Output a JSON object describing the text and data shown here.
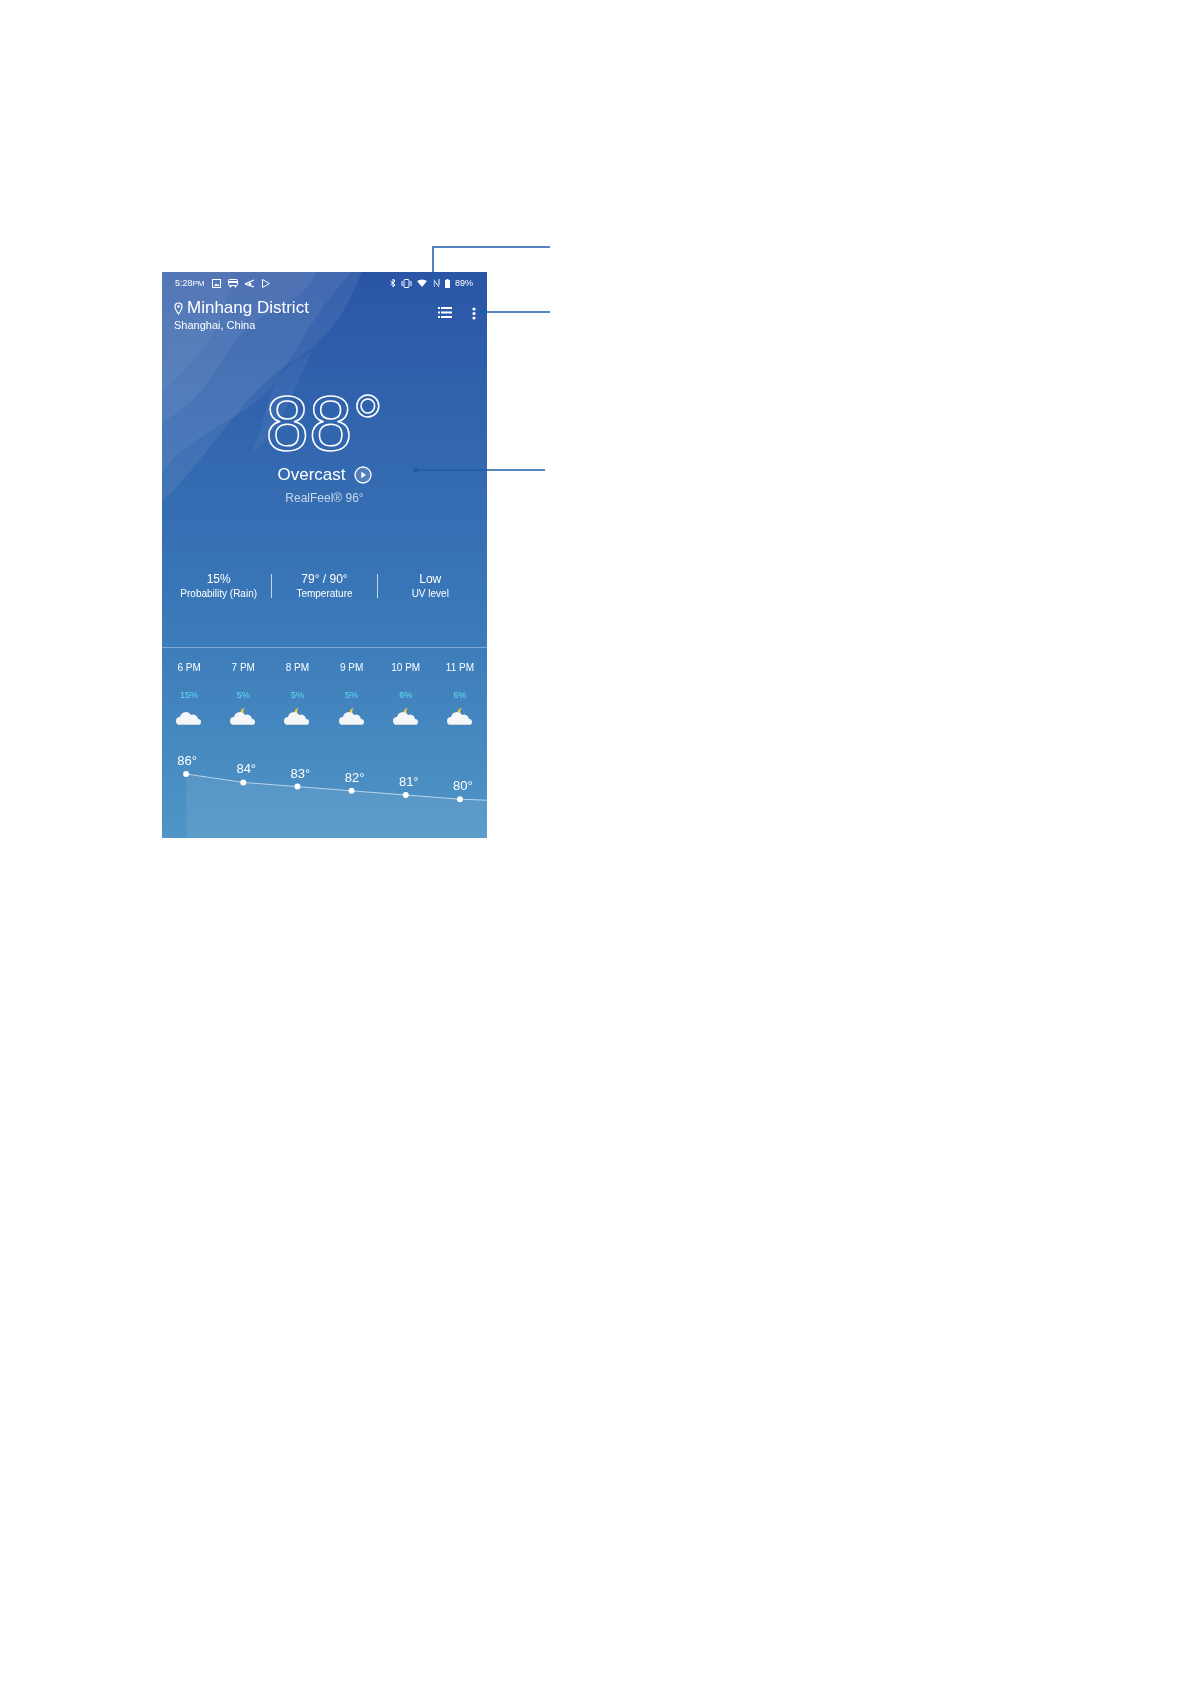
{
  "status_bar": {
    "time": "5:28",
    "meridiem": "PM",
    "battery": "89%"
  },
  "location": {
    "name": "Minhang District",
    "region": "Shanghai, China"
  },
  "current": {
    "temperature": "88°",
    "condition": "Overcast",
    "realfeel": "RealFeel® 96°"
  },
  "stats": [
    {
      "value": "15%",
      "label": "Probability (Rain)"
    },
    {
      "value": "79° / 90°",
      "label": "Temperature"
    },
    {
      "value": "Low",
      "label": "UV level"
    }
  ],
  "hourly": [
    {
      "time": "6 PM",
      "precip": "15%",
      "kind": "cloudy",
      "temp": "86°"
    },
    {
      "time": "7 PM",
      "precip": "5%",
      "kind": "cloudy-night",
      "temp": "84°"
    },
    {
      "time": "8 PM",
      "precip": "5%",
      "kind": "cloudy-night",
      "temp": "83°"
    },
    {
      "time": "9 PM",
      "precip": "5%",
      "kind": "cloudy-night",
      "temp": "82°"
    },
    {
      "time": "10 PM",
      "precip": "6%",
      "kind": "cloudy-night",
      "temp": "81°"
    },
    {
      "time": "11 PM",
      "precip": "6%",
      "kind": "cloudy-night",
      "temp": "80°"
    }
  ]
}
